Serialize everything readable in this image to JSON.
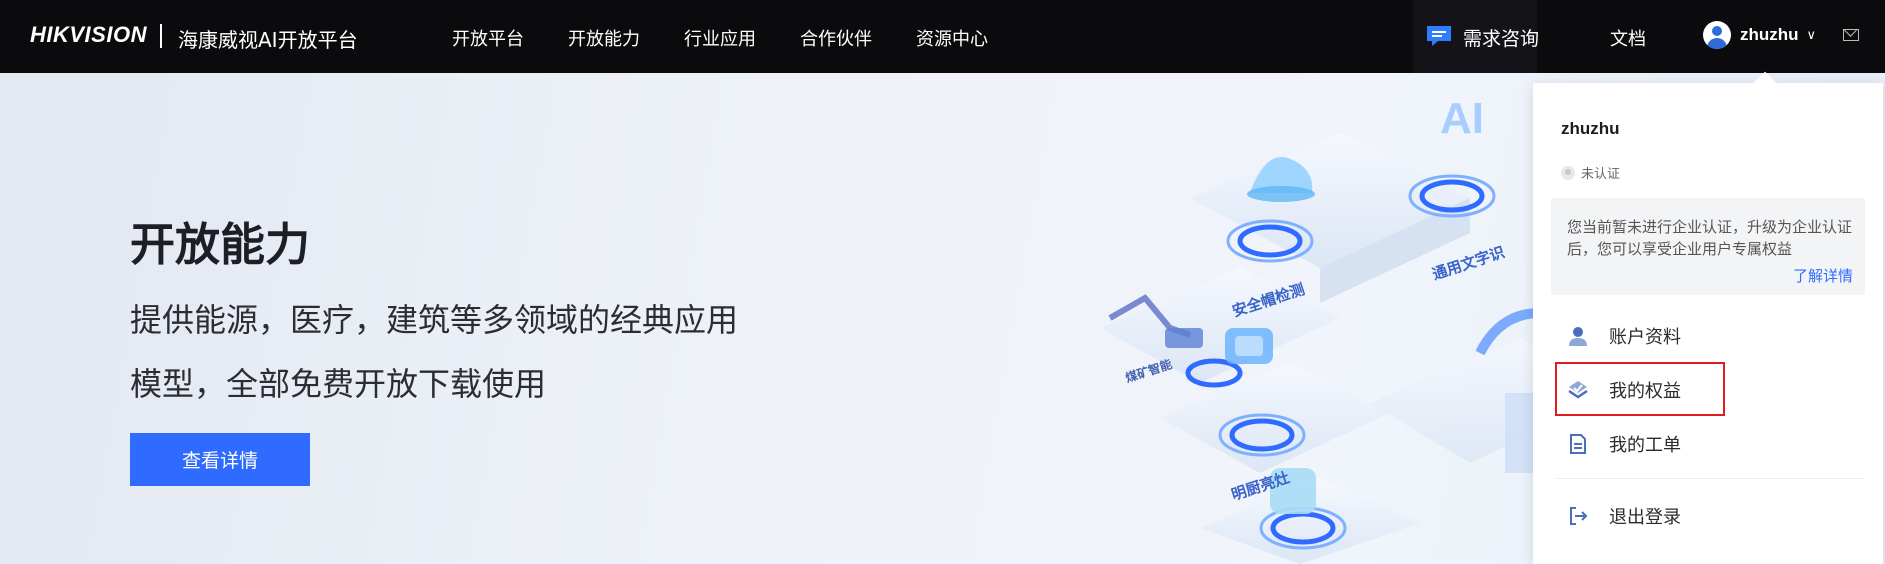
{
  "header": {
    "logo": "HIKVISION",
    "platform_title": "海康威视AI开放平台",
    "nav": [
      {
        "label": "开放平台"
      },
      {
        "label": "开放能力"
      },
      {
        "label": "行业应用"
      },
      {
        "label": "合作伙伴"
      },
      {
        "label": "资源中心"
      }
    ],
    "consult_label": "需求咨询",
    "docs_label": "文档",
    "username": "zhuzhu"
  },
  "hero": {
    "title": "开放能力",
    "description": "提供能源，医疗，建筑等多领域的经典应用模型，全部免费开放下载使用",
    "button_label": "查看详情",
    "art_labels": [
      "安全帽检测",
      "通用文字识",
      "煤矿智能",
      "明厨亮灶"
    ]
  },
  "user_menu": {
    "name": "zhuzhu",
    "auth_status": "未认证",
    "notice_text": "您当前暂未进行企业认证，升级为企业认证后，您可以享受企业用户专属权益",
    "notice_link": "了解详情",
    "items": [
      {
        "label": "账户资料",
        "icon": "user-icon"
      },
      {
        "label": "我的权益",
        "icon": "rights-icon"
      },
      {
        "label": "我的工单",
        "icon": "ticket-icon"
      },
      {
        "label": "退出登录",
        "icon": "logout-icon"
      }
    ]
  },
  "colors": {
    "accent": "#2f6bff",
    "topbar": "#0b0b0d",
    "highlight": "#e21c1c"
  }
}
